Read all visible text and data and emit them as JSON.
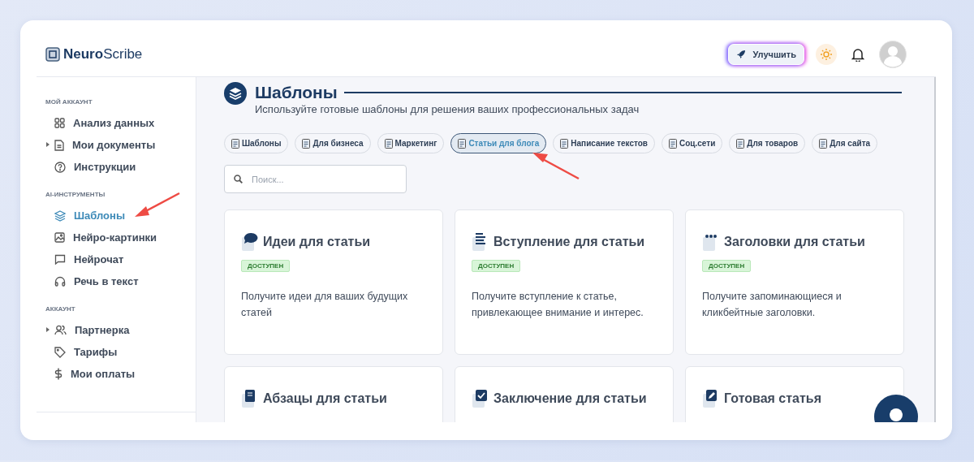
{
  "logo": {
    "bold": "Neuro",
    "rest": "Scribe"
  },
  "header": {
    "upgrade_label": "Улучшить"
  },
  "sidebar": {
    "sections": [
      {
        "title": "МОЙ АККАУНТ",
        "items": [
          {
            "label": "Анализ данных",
            "expandable": false,
            "selected": false,
            "annotated": false
          },
          {
            "label": "Мои документы",
            "expandable": true,
            "selected": false,
            "annotated": false
          },
          {
            "label": "Инструкции",
            "expandable": false,
            "selected": false,
            "annotated": false
          }
        ]
      },
      {
        "title": "AI-ИНСТРУМЕНТЫ",
        "items": [
          {
            "label": "Шаблоны",
            "expandable": false,
            "selected": true,
            "annotated": true
          },
          {
            "label": "Нейро-картинки",
            "expandable": false,
            "selected": false,
            "annotated": false
          },
          {
            "label": "Нейрочат",
            "expandable": false,
            "selected": false,
            "annotated": false
          },
          {
            "label": "Речь в текст",
            "expandable": false,
            "selected": false,
            "annotated": false
          }
        ]
      },
      {
        "title": "АККАУНТ",
        "items": [
          {
            "label": "Партнерка",
            "expandable": true,
            "selected": false,
            "annotated": false
          },
          {
            "label": "Тарифы",
            "expandable": false,
            "selected": false,
            "annotated": false
          },
          {
            "label": "Мои оплаты",
            "expandable": false,
            "selected": false,
            "annotated": false
          }
        ]
      }
    ]
  },
  "page": {
    "title": "Шаблоны",
    "subtitle": "Используйте готовые шаблоны для решения ваших профессиональных задач"
  },
  "tabs": [
    {
      "label": "Шаблоны",
      "selected": false,
      "annotated": false
    },
    {
      "label": "Для бизнеса",
      "selected": false,
      "annotated": false
    },
    {
      "label": "Маркетинг",
      "selected": false,
      "annotated": false
    },
    {
      "label": "Статьи для блога",
      "selected": true,
      "annotated": true
    },
    {
      "label": "Написание текстов",
      "selected": false,
      "annotated": false
    },
    {
      "label": "Соц.сети",
      "selected": false,
      "annotated": false
    },
    {
      "label": "Для товаров",
      "selected": false,
      "annotated": false
    },
    {
      "label": "Для сайта",
      "selected": false,
      "annotated": false
    }
  ],
  "search": {
    "placeholder": "Поиск..."
  },
  "cards": [
    {
      "title": "Идеи для статьи",
      "badge": "ДОСТУПЕН",
      "description": "Получите идеи для ваших будущих статей"
    },
    {
      "title": "Вступление для статьи",
      "badge": "ДОСТУПЕН",
      "description": "Получите вступление к статье, привлекающее внимание и интерес."
    },
    {
      "title": "Заголовки для статьи",
      "badge": "ДОСТУПЕН",
      "description": "Получите запоминающиеся и кликбейтные заголовки."
    },
    {
      "title": "Абзацы для статьи"
    },
    {
      "title": "Заключение для статьи"
    },
    {
      "title": "Готовая статья"
    }
  ]
}
